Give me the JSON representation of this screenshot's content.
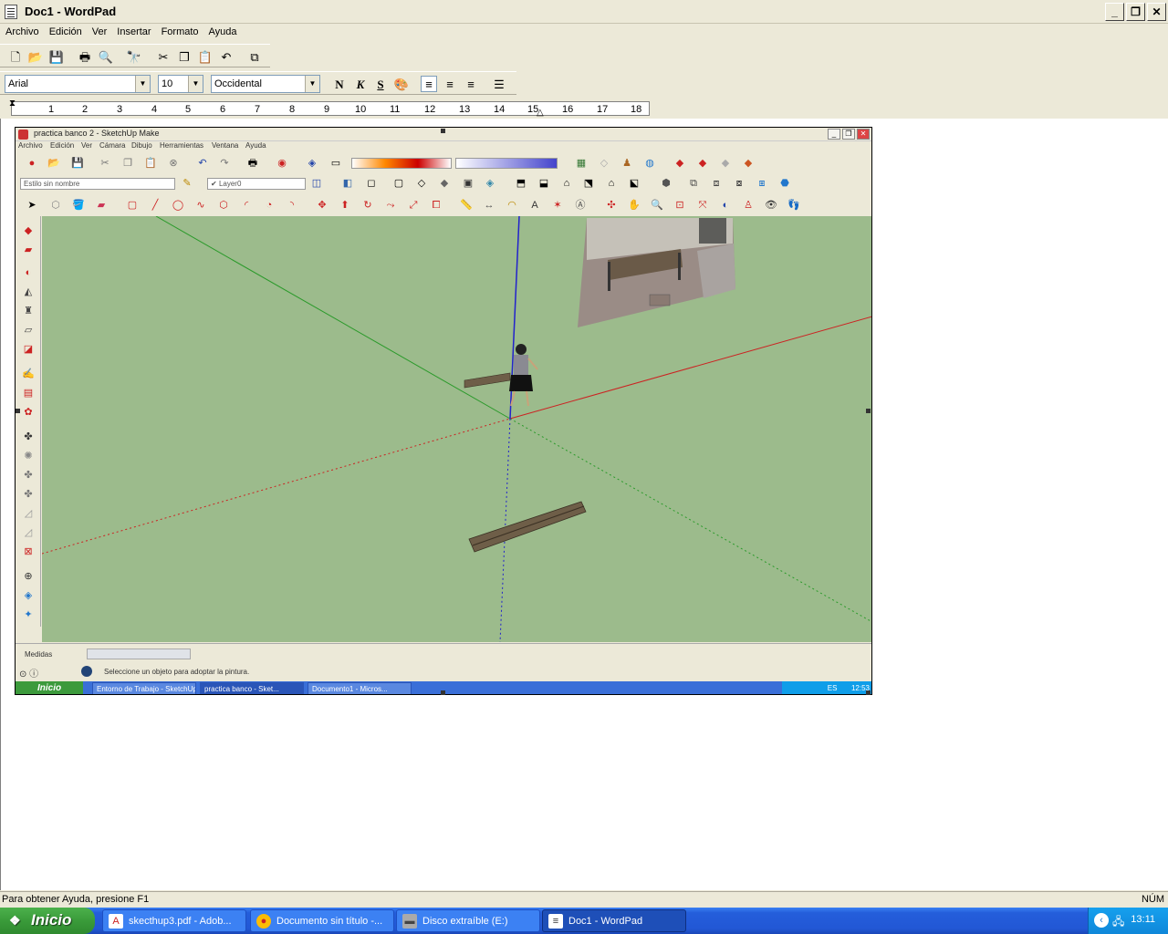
{
  "window": {
    "title": "Doc1 - WordPad"
  },
  "menu": [
    "Archivo",
    "Edición",
    "Ver",
    "Insertar",
    "Formato",
    "Ayuda"
  ],
  "format": {
    "font": "Arial",
    "size": "10",
    "script": "Occidental"
  },
  "ruler": {
    "numbers": [
      "1",
      "2",
      "3",
      "4",
      "5",
      "6",
      "7",
      "8",
      "9",
      "10",
      "11",
      "12",
      "13",
      "14",
      "15",
      "16",
      "17",
      "18"
    ]
  },
  "sketchup": {
    "title": "practica banco 2 - SketchUp Make",
    "menu": [
      "Archivo",
      "Edición",
      "Ver",
      "Cámara",
      "Dibujo",
      "Herramientas",
      "Ventana",
      "Ayuda"
    ],
    "style_combo": "Estilo sin nombre",
    "layer_combo": "Layer0",
    "measure_label": "Medidas",
    "status_hint": "Seleccione un objeto para adoptar la pintura.",
    "taskbar": {
      "start": "Inicio",
      "items": [
        "Entorno de Trabajo - SketchUp...",
        "practica banco - Sket...",
        "Documento1 - Micros..."
      ],
      "lang": "ES",
      "clock": "12:53"
    }
  },
  "status": {
    "help": "Para obtener Ayuda, presione F1",
    "num": "NÚM"
  },
  "taskbar": {
    "start": "Inicio",
    "items": [
      {
        "label": "skecthup3.pdf - Adob...",
        "icon": "pdf-icon"
      },
      {
        "label": "Documento sin título -...",
        "icon": "chrome-icon"
      },
      {
        "label": "Disco extraíble (E:)",
        "icon": "drive-icon"
      },
      {
        "label": "Doc1 - WordPad",
        "icon": "wordpad-icon"
      }
    ],
    "clock": "13:11"
  }
}
